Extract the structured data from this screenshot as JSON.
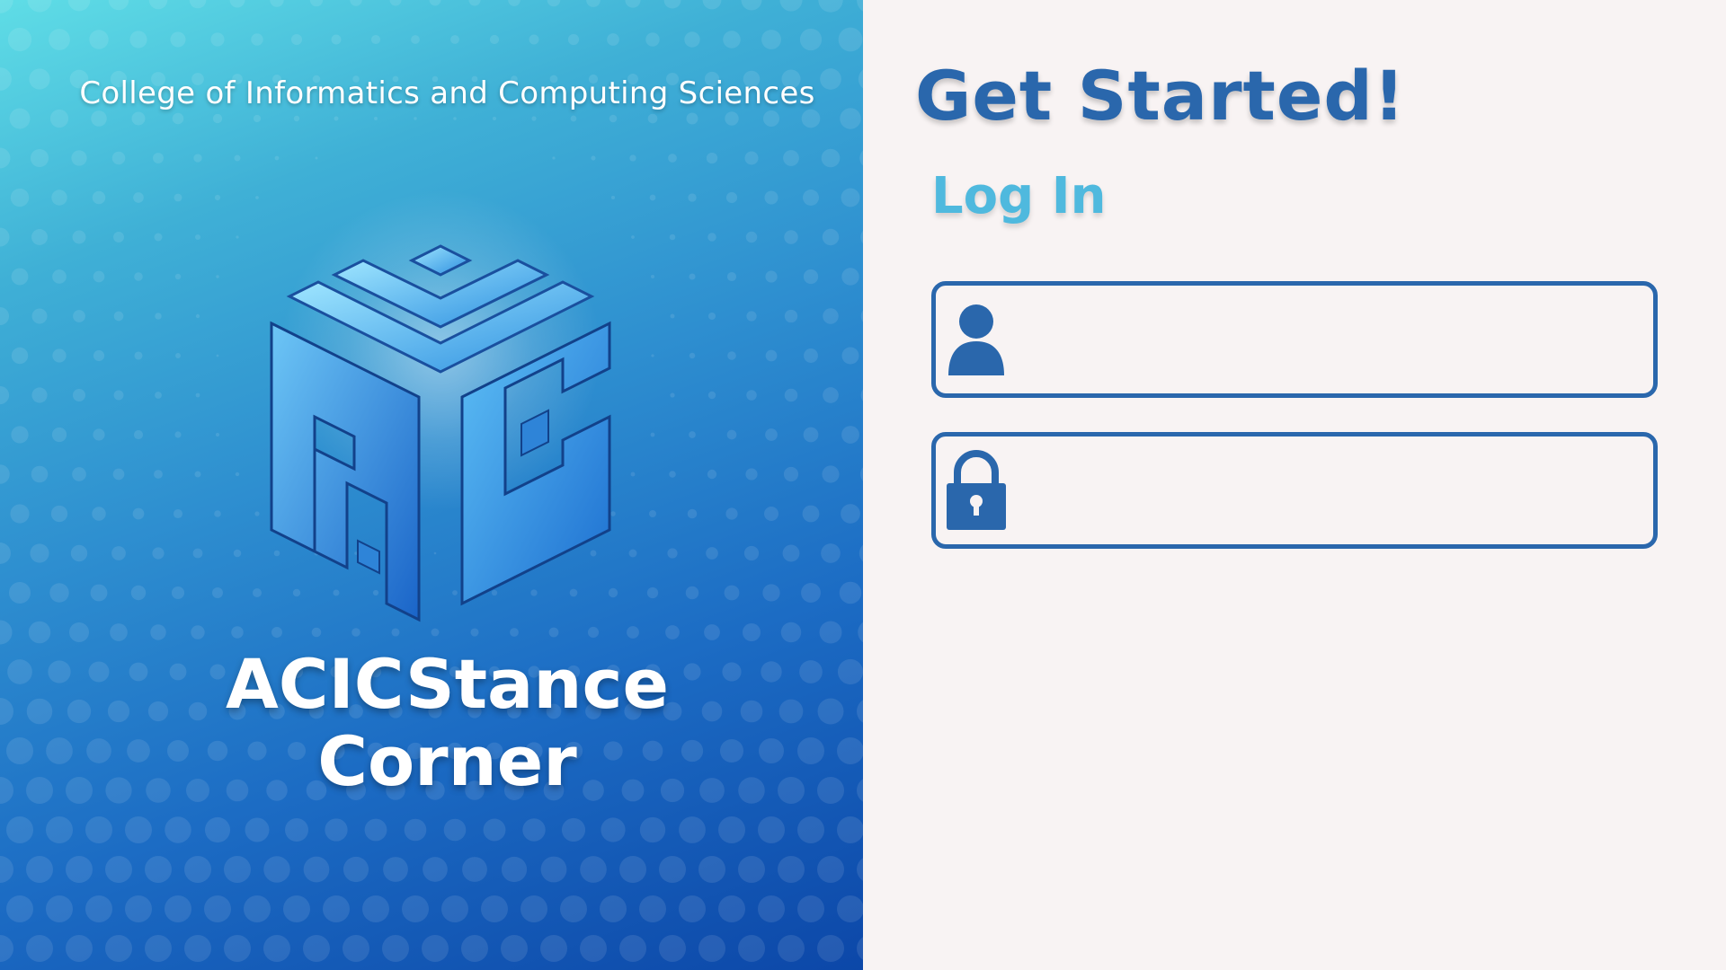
{
  "brand": {
    "college": "College of Informatics and Computing Sciences",
    "app_name_line1": "ACICStance",
    "app_name_line2": "Corner",
    "logo_icon": "acic-cube-logo"
  },
  "login": {
    "heading": "Get Started!",
    "subheading": "Log In",
    "username": {
      "value": "",
      "placeholder": "",
      "icon": "user-icon"
    },
    "password": {
      "value": "",
      "placeholder": "",
      "icon": "lock-icon"
    }
  },
  "colors": {
    "accent": "#2a67ac",
    "accent_light": "#4fb9de",
    "panel_bg": "#f8f3f3",
    "gradient_start": "#5fdde6",
    "gradient_end": "#0c47a8"
  }
}
